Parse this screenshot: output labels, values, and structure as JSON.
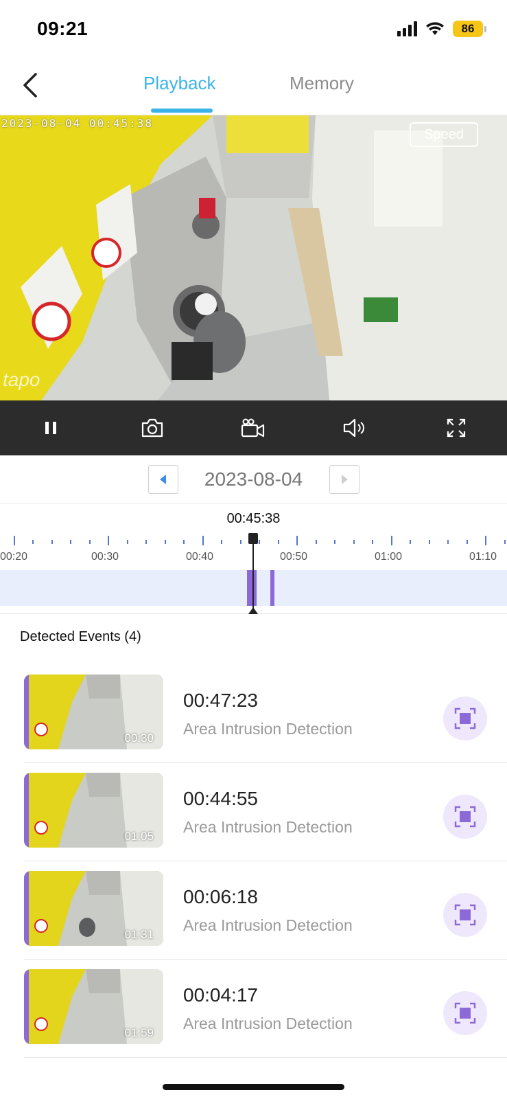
{
  "status_bar": {
    "time": "09:21",
    "battery": "86"
  },
  "header": {
    "tabs": [
      {
        "label": "Playback",
        "active": true
      },
      {
        "label": "Memory",
        "active": false
      }
    ],
    "accent_color": "#3bb3e8"
  },
  "video": {
    "timestamp_overlay": "2023-08-04  00:45:38",
    "speed_label": "Speed",
    "watermark": "tapo"
  },
  "controls": [
    "pause-icon",
    "camera-icon",
    "record-icon",
    "speaker-icon",
    "fullscreen-icon"
  ],
  "date_picker": {
    "date": "2023-08-04"
  },
  "timeline": {
    "current_time": "00:45:38",
    "tick_labels": [
      "00:20",
      "00:30",
      "00:40",
      "00:50",
      "01:00",
      "01:10"
    ],
    "event_color": "#8b6ad8"
  },
  "events": {
    "title": "Detected Events (4)",
    "items": [
      {
        "time": "00:47:23",
        "type": "Area Intrusion Detection",
        "duration": "00:30"
      },
      {
        "time": "00:44:55",
        "type": "Area Intrusion Detection",
        "duration": "01:05"
      },
      {
        "time": "00:06:18",
        "type": "Area Intrusion Detection",
        "duration": "01:31"
      },
      {
        "time": "00:04:17",
        "type": "Area Intrusion Detection",
        "duration": "01:59"
      }
    ]
  }
}
